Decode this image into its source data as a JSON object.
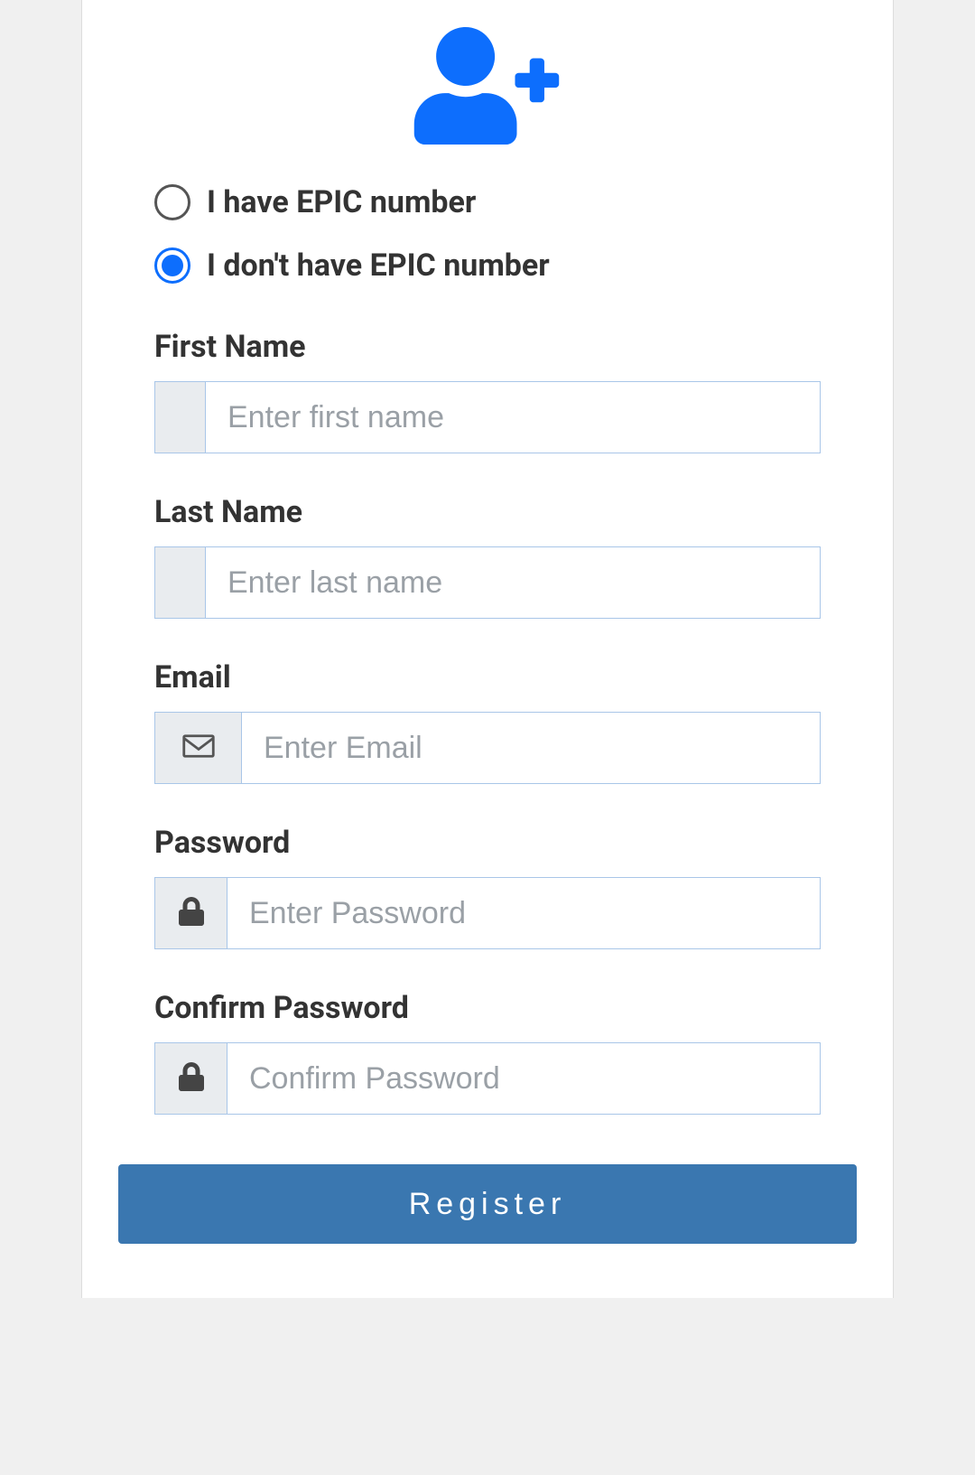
{
  "radios": {
    "have_epic": {
      "label": "I have EPIC number",
      "selected": false
    },
    "no_epic": {
      "label": "I don't have EPIC number",
      "selected": true
    }
  },
  "fields": {
    "first_name": {
      "label": "First Name",
      "placeholder": "Enter first name",
      "value": ""
    },
    "last_name": {
      "label": "Last Name",
      "placeholder": "Enter last name",
      "value": ""
    },
    "email": {
      "label": "Email",
      "placeholder": "Enter Email",
      "value": ""
    },
    "password": {
      "label": "Password",
      "placeholder": "Enter Password",
      "value": ""
    },
    "confirm_password": {
      "label": "Confirm Password",
      "placeholder": "Confirm Password",
      "value": ""
    }
  },
  "buttons": {
    "register": "Register"
  },
  "colors": {
    "accent": "#0d6efd",
    "button": "#3a77b0",
    "border": "#a9c6e8"
  }
}
